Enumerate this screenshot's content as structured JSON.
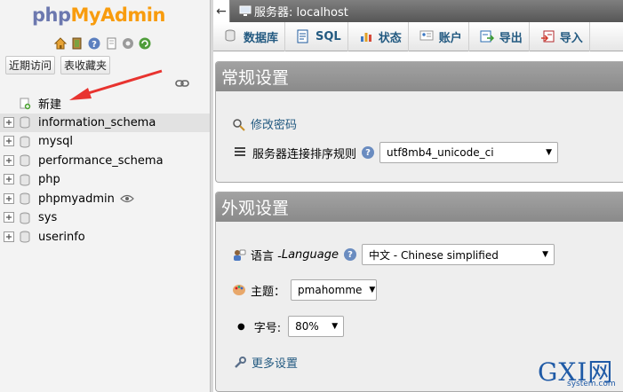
{
  "logo": {
    "part1": "php",
    "part2": "MyAdmin"
  },
  "nav": {
    "icons": [
      "home-icon",
      "exit-icon",
      "help-icon",
      "docs-icon",
      "settings-gear-icon",
      "reload-icon"
    ],
    "recent_label": "近期访问",
    "favorites_label": "表收藏夹",
    "new_label": "新建",
    "databases": [
      "information_schema",
      "mysql",
      "performance_schema",
      "php",
      "phpmyadmin",
      "sys",
      "userinfo"
    ],
    "highlighted": "information_schema",
    "arrow_color": "#e8332f"
  },
  "topbar": {
    "back_glyph": "←",
    "title": "服务器: localhost"
  },
  "tabs": [
    {
      "label": "数据库",
      "icon": "database-icon"
    },
    {
      "label": "SQL",
      "icon": "sql-icon"
    },
    {
      "label": "状态",
      "icon": "status-chart-icon"
    },
    {
      "label": "账户",
      "icon": "user-card-icon"
    },
    {
      "label": "导出",
      "icon": "export-icon"
    },
    {
      "label": "导入",
      "icon": "import-icon"
    }
  ],
  "general": {
    "title": "常规设置",
    "change_password": "修改密码",
    "collation_label": "服务器连接排序规则",
    "collation_help": "?",
    "collation_value": "utf8mb4_unicode_ci"
  },
  "appearance": {
    "title": "外观设置",
    "language_label": "语言 - ",
    "language_label_en": "Language",
    "language_value": "中文 - Chinese simplified",
    "theme_label": "主题",
    "theme_colon": "：",
    "theme_value": "pmahomme",
    "font_label": "字号:",
    "font_value": "80%",
    "more_settings": "更多设置"
  },
  "watermark": {
    "brand": "GXI网",
    "site": "system.com"
  },
  "colors": {
    "link": "#235a81",
    "panel_header": "#919191",
    "topbar": "#666666",
    "nav_bg": "#f3f3f3"
  }
}
